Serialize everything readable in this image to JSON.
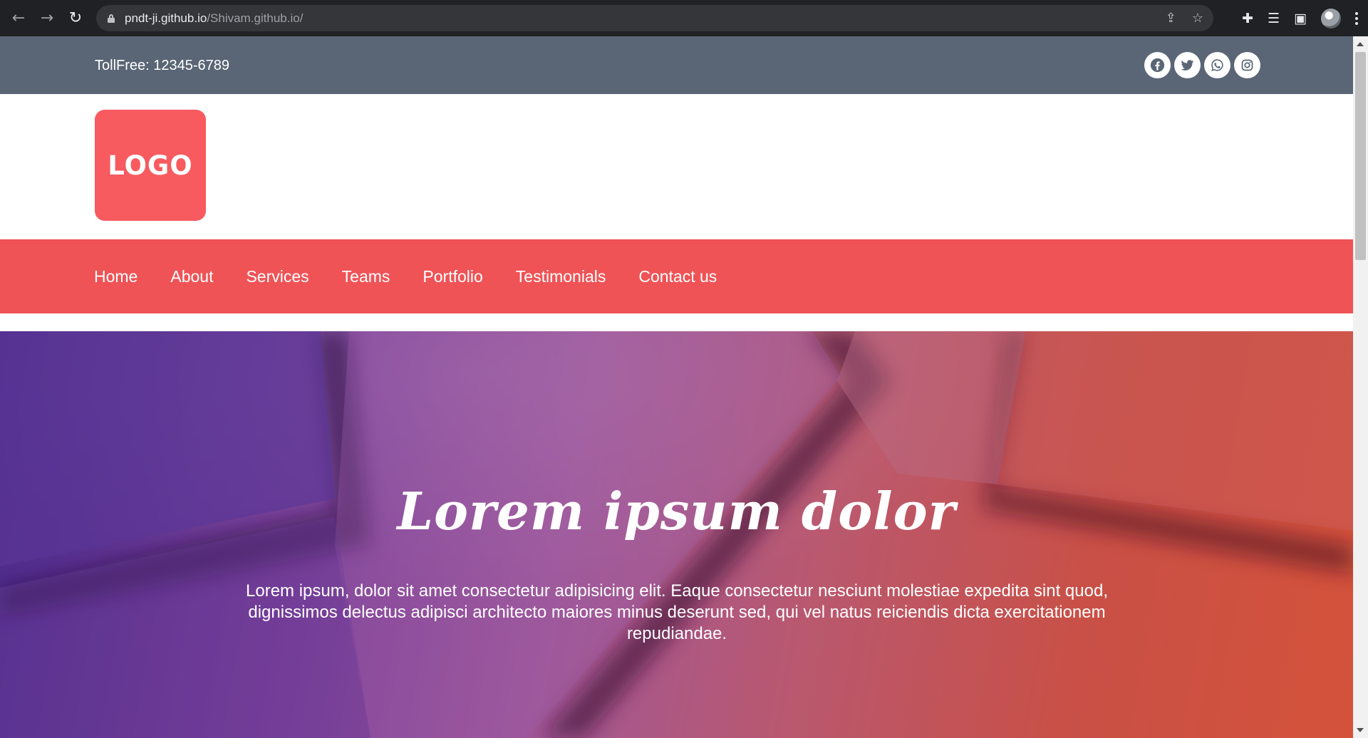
{
  "browser": {
    "url_host": "pndt-ji.github.io",
    "url_path": "/Shivam.github.io/",
    "icons": {
      "back": "arrow-left-icon",
      "forward": "arrow-right-icon",
      "reload": "reload-icon",
      "lock": "lock-icon",
      "share": "share-icon",
      "bookmark": "star-icon",
      "extensions": "puzzle-icon",
      "reading_list": "reading-list-icon",
      "side_panel": "side-panel-icon",
      "profile": "avatar",
      "menu": "kebab-menu-icon"
    }
  },
  "topbar": {
    "tollfree": "TollFree: 12345-6789",
    "socials": [
      "facebook-icon",
      "twitter-icon",
      "whatsapp-icon",
      "instagram-icon"
    ]
  },
  "logo": {
    "text": "LOGO",
    "color": "#f75a5f"
  },
  "nav": {
    "items": [
      "Home",
      "About",
      "Services",
      "Teams",
      "Portfolio",
      "Testimonials",
      "Contact us"
    ],
    "bg_color": "#ef5356"
  },
  "hero": {
    "title": "Lorem ipsum dolor",
    "text": "Lorem ipsum, dolor sit amet consectetur adipisicing elit. Eaque consectetur nesciunt molestiae expedita sint quod, dignissimos delectus adipisci architecto maiores minus deserunt sed, qui vel natus reiciendis dicta exercitationem repudiandae."
  },
  "colors": {
    "topbar": "#5a6676",
    "browser_chrome": "#202124"
  }
}
